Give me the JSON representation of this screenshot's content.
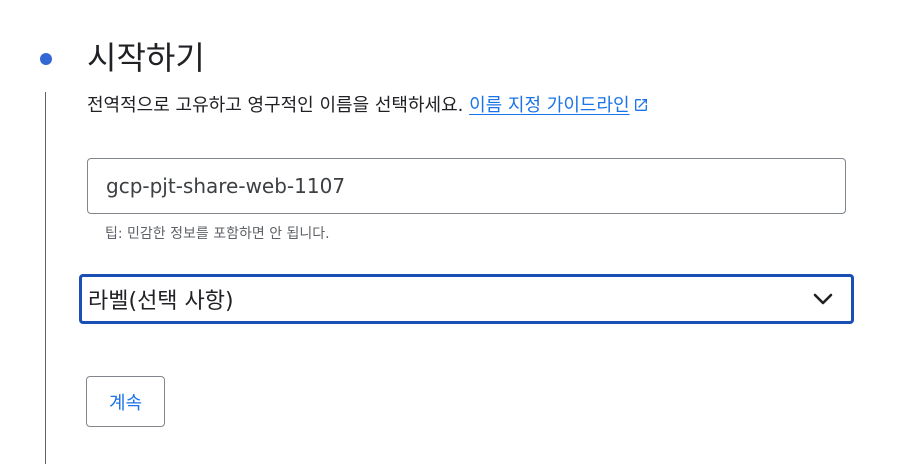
{
  "step": {
    "title": "시작하기",
    "accent_color": "#3367d6"
  },
  "description": {
    "text": "전역적으로 고유하고 영구적인 이름을 선택하세요. ",
    "link_label": "이름 지정 가이드라인",
    "link_icon": "open-in-new-icon"
  },
  "name_field": {
    "value": "gcp-pjt-share-web-1107",
    "hint": "팁: 민감한 정보를 포함하면 안 됩니다."
  },
  "labels_select": {
    "label": "라벨(선택 사항)",
    "icon": "chevron-down-icon"
  },
  "actions": {
    "continue_label": "계속"
  }
}
